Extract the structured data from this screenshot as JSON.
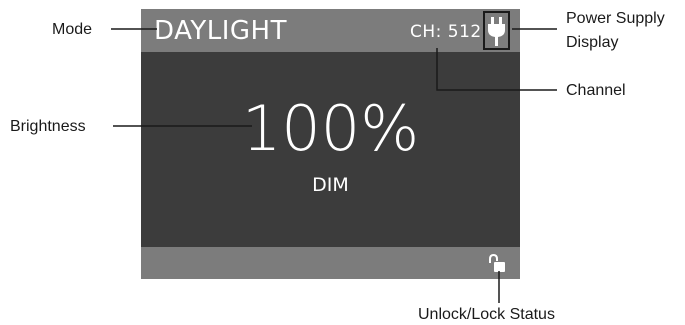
{
  "screen": {
    "mode": "DAYLIGHT",
    "channel": "CH: 512",
    "brightness": "100%",
    "dimming": "DIM",
    "power_icon": "plug-icon",
    "lock_icon": "unlocked-padlock-icon"
  },
  "callouts": {
    "mode": "Mode",
    "power_line1": "Power Supply",
    "power_line2": "Display",
    "channel": "Channel",
    "brightness": "Brightness",
    "lock": "Unlock/Lock Status"
  },
  "colors": {
    "bar": "#7c7c7c",
    "panel": "#3c3c3c",
    "text": "#ffffff",
    "line": "#1a1a1a"
  }
}
